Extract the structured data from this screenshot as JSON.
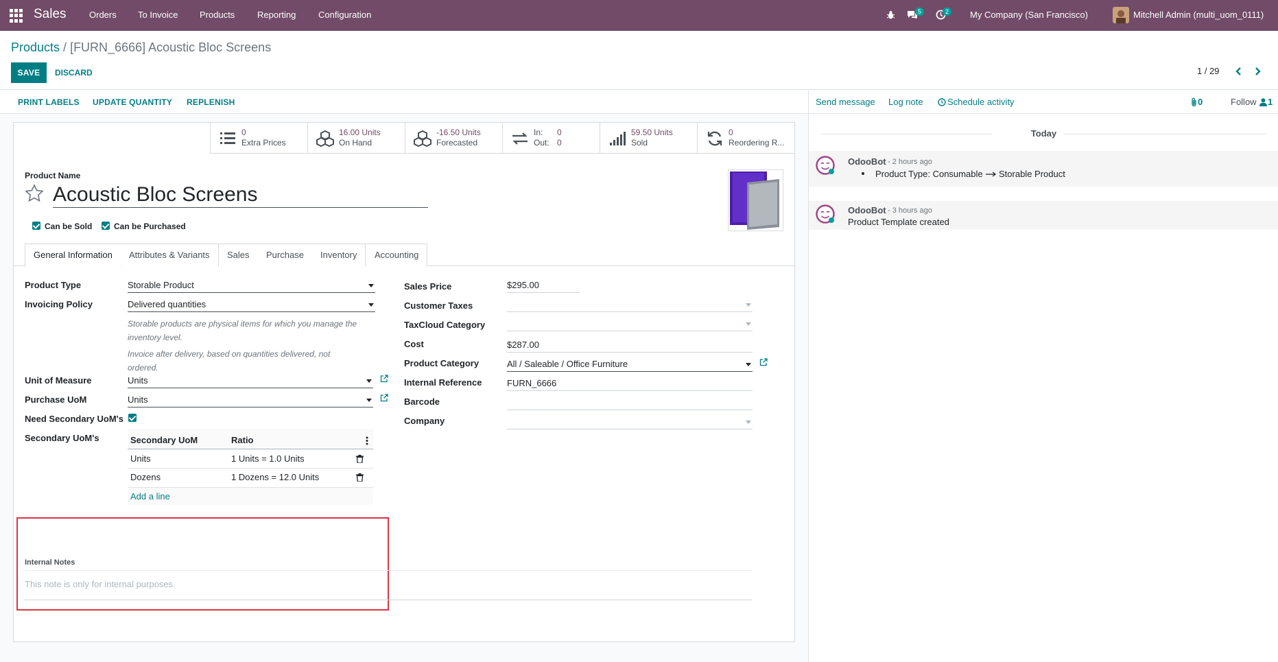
{
  "nav": {
    "brand": "Sales",
    "menu": [
      "Orders",
      "To Invoice",
      "Products",
      "Reporting",
      "Configuration"
    ],
    "chat_count": "5",
    "activity_count": "2",
    "company": "My Company (San Francisco)",
    "user": "Mitchell Admin (multi_uom_0111)"
  },
  "breadcrumb": {
    "parent": "Products",
    "separator": " / ",
    "current": "[FURN_6666] Acoustic Bloc Screens"
  },
  "controls": {
    "save": "SAVE",
    "discard": "DISCARD",
    "pager": "1 / 29"
  },
  "statusbar": {
    "print_labels": "PRINT LABELS",
    "update_quantity": "UPDATE QUANTITY",
    "replenish": "REPLENISH"
  },
  "smart_buttons": [
    {
      "value": "0",
      "label": "Extra Prices"
    },
    {
      "value": "16.00 Units",
      "label": "On Hand"
    },
    {
      "value": "-16.50 Units",
      "label": "Forecasted"
    },
    {
      "in_label": "In:",
      "in_value": "0",
      "out_label": "Out:",
      "out_value": "0"
    },
    {
      "value": "59.50 Units",
      "label": "Sold"
    },
    {
      "value": "0",
      "label": "Reordering R..."
    }
  ],
  "product": {
    "name_label": "Product Name",
    "name": "Acoustic Bloc Screens",
    "can_be_sold": "Can be Sold",
    "can_be_purchased": "Can be Purchased"
  },
  "tabs": [
    "General Information",
    "Attributes & Variants",
    "Sales",
    "Purchase",
    "Inventory",
    "Accounting"
  ],
  "left_fields": {
    "product_type_label": "Product Type",
    "product_type": "Storable Product",
    "invoicing_policy_label": "Invoicing Policy",
    "invoicing_policy": "Delivered quantities",
    "help1_line1": "Storable products are physical items for which you manage the",
    "help1_line2": "inventory level.",
    "help2_line1": "Invoice after delivery, based on quantities delivered, not",
    "help2_line2": "ordered.",
    "uom_label": "Unit of Measure",
    "uom": "Units",
    "purchase_uom_label": "Purchase UoM",
    "purchase_uom": "Units",
    "need_secondary_label": "Need Secondary UoM's",
    "secondary_label": "Secondary UoM's"
  },
  "secondary_uoms": {
    "col_uom": "Secondary UoM",
    "col_ratio": "Ratio",
    "rows": [
      {
        "uom": "Units",
        "ratio": "1 Units = 1.0 Units"
      },
      {
        "uom": "Dozens",
        "ratio": "1 Dozens = 12.0 Units"
      }
    ],
    "add_line": "Add a line"
  },
  "right_fields": {
    "sales_price_label": "Sales Price",
    "sales_price": "$295.00",
    "customer_taxes_label": "Customer Taxes",
    "taxcloud_label": "TaxCloud Category",
    "cost_label": "Cost",
    "cost": "$287.00",
    "category_label": "Product Category",
    "category": "All / Saleable / Office Furniture",
    "internal_ref_label": "Internal Reference",
    "internal_ref": "FURN_6666",
    "barcode_label": "Barcode",
    "company_label": "Company"
  },
  "notes": {
    "label": "Internal Notes",
    "placeholder": "This note is only for internal purposes."
  },
  "chatter": {
    "send_message": "Send message",
    "log_note": "Log note",
    "schedule_activity": "Schedule activity",
    "attachments": "0",
    "follow": "Follow",
    "followers": "1",
    "today": "Today",
    "messages": [
      {
        "author": "OdooBot",
        "date": "- 2 hours ago",
        "old": "Product Type: Consumable",
        "new": "Storable Product"
      },
      {
        "author": "OdooBot",
        "date": "- 3 hours ago",
        "body": "Product Template created"
      }
    ]
  },
  "colors": {
    "primary": "#714B67",
    "accent": "#017e84",
    "highlight_border": "#dc3545"
  }
}
